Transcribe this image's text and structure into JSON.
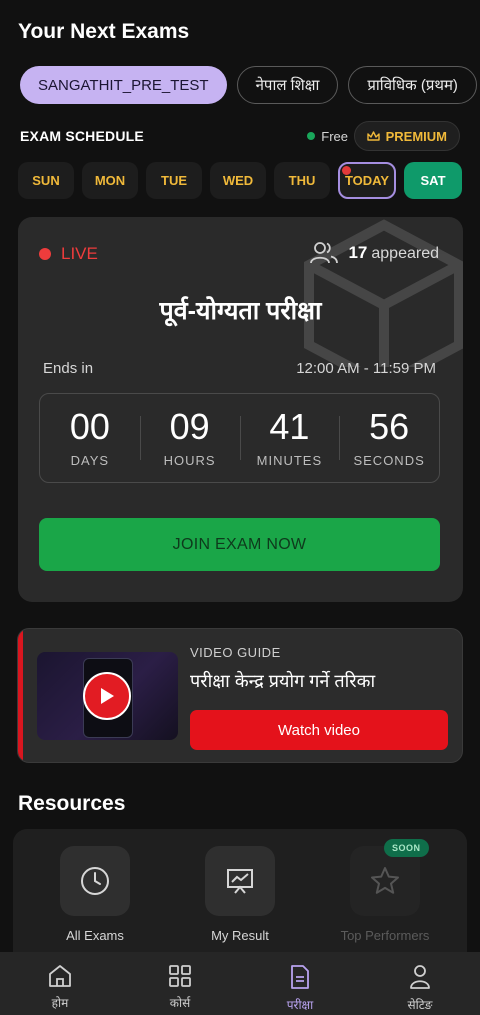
{
  "header": {
    "title": "Your Next Exams"
  },
  "exam_chips": [
    {
      "label": "SANGATHIT_PRE_TEST",
      "active": true
    },
    {
      "label": "नेपाल शिक्षा",
      "active": false
    },
    {
      "label": "प्राविधिक (प्रथम)",
      "active": false
    }
  ],
  "schedule": {
    "title": "EXAM SCHEDULE",
    "free_label": "Free",
    "premium_label": "PREMIUM",
    "days": [
      "SUN",
      "MON",
      "TUE",
      "WED",
      "THU",
      "TODAY",
      "SAT"
    ]
  },
  "exam_card": {
    "live_label": "LIVE",
    "appeared_count": "17",
    "appeared_label": "appeared",
    "exam_name": "पूर्व-योग्यता परीक्षा",
    "ends_label": "Ends in",
    "time_range": "12:00 AM - 11:59 PM",
    "countdown": [
      {
        "value": "00",
        "label": "DAYS"
      },
      {
        "value": "09",
        "label": "HOURS"
      },
      {
        "value": "41",
        "label": "MINUTES"
      },
      {
        "value": "56",
        "label": "SECONDS"
      }
    ],
    "join_label": "JOIN EXAM NOW"
  },
  "video_guide": {
    "label": "VIDEO GUIDE",
    "title": "परीक्षा केन्द्र प्रयोग गर्ने तरिका",
    "button_label": "Watch video"
  },
  "resources": {
    "title": "Resources",
    "items": [
      {
        "label": "All Exams",
        "icon": "clock-icon"
      },
      {
        "label": "My Result",
        "icon": "chart-board-icon"
      },
      {
        "label": "Top Performers",
        "icon": "star-icon",
        "badge": "SOON"
      }
    ]
  },
  "bottom_nav": [
    {
      "label": "होम",
      "icon": "home-icon"
    },
    {
      "label": "कोर्स",
      "icon": "grid-icon"
    },
    {
      "label": "परीक्षा",
      "icon": "document-icon",
      "active": true
    },
    {
      "label": "सेटिङ",
      "icon": "user-icon"
    }
  ],
  "colors": {
    "accent": "#c6b3f2",
    "live": "#ee3c3c",
    "join": "#1aa648",
    "premium": "#f0b93a",
    "sat": "#0f9a6a"
  }
}
